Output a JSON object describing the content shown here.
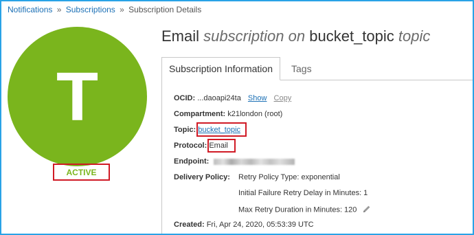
{
  "breadcrumb": {
    "items": [
      "Notifications",
      "Subscriptions",
      "Subscription Details"
    ],
    "separator": "»"
  },
  "subscription": {
    "avatar_letter": "T",
    "status": "ACTIVE",
    "title_protocol": "Email",
    "title_subscription_on": "subscription on",
    "title_topic_name": "bucket_topic",
    "title_topic_word": "topic"
  },
  "tabs": [
    {
      "label": "Subscription Information",
      "active": true
    },
    {
      "label": "Tags",
      "active": false
    }
  ],
  "details": {
    "ocid_label": "OCID:",
    "ocid_value": "...daoapi24ta",
    "show_label": "Show",
    "copy_label": "Copy",
    "compartment_label": "Compartment:",
    "compartment_value": "k21london (root)",
    "topic_label": "Topic:",
    "topic_value": "bucket_topic",
    "protocol_label": "Protocol:",
    "protocol_value": "Email",
    "endpoint_label": "Endpoint:",
    "delivery_policy_label": "Delivery Policy:",
    "retry_policy_type": "Retry Policy Type: exponential",
    "initial_failure_retry": "Initial Failure Retry Delay in Minutes: 1",
    "max_retry_duration": "Max Retry Duration in Minutes: 120",
    "created_label": "Created:",
    "created_value": "Fri, Apr 24, 2020, 05:53:39 UTC"
  },
  "colors": {
    "accent_frame": "#29a3e6",
    "avatar_green": "#7ab51d",
    "highlight_red": "#d01a25",
    "link_blue": "#1a6fb5"
  },
  "icons": {
    "edit": "pencil-icon"
  }
}
